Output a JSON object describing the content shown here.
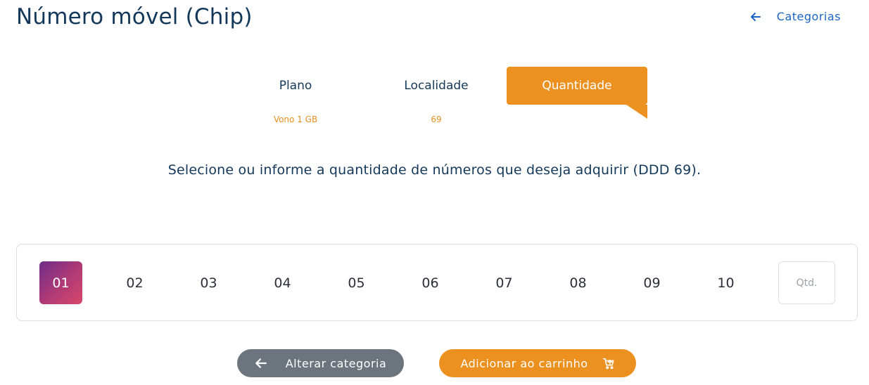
{
  "header": {
    "title": "Número móvel (Chip)",
    "back_link_label": "Categorias",
    "back_icon": "arrow-left-icon"
  },
  "stepper": {
    "steps": [
      {
        "label": "Plano",
        "value": "Vono 1 GB",
        "active": false
      },
      {
        "label": "Localidade",
        "value": "69",
        "active": false
      },
      {
        "label": "Quantidade",
        "value": "",
        "active": true
      }
    ],
    "active_color": "#ec9120"
  },
  "instruction": "Selecione ou informe a quantidade de números que deseja adquirir (DDD 69).",
  "quantity": {
    "options": [
      "01",
      "02",
      "03",
      "04",
      "05",
      "06",
      "07",
      "08",
      "09",
      "10"
    ],
    "selected": "01",
    "input_placeholder": "Qtd.",
    "input_value": ""
  },
  "actions": {
    "back_label": "Alterar categoria",
    "back_icon": "arrow-left-icon",
    "cart_label": "Adicionar ao carrinho",
    "cart_icon": "cart-icon",
    "back_color": "#6c757d",
    "cart_color": "#ec9120"
  }
}
